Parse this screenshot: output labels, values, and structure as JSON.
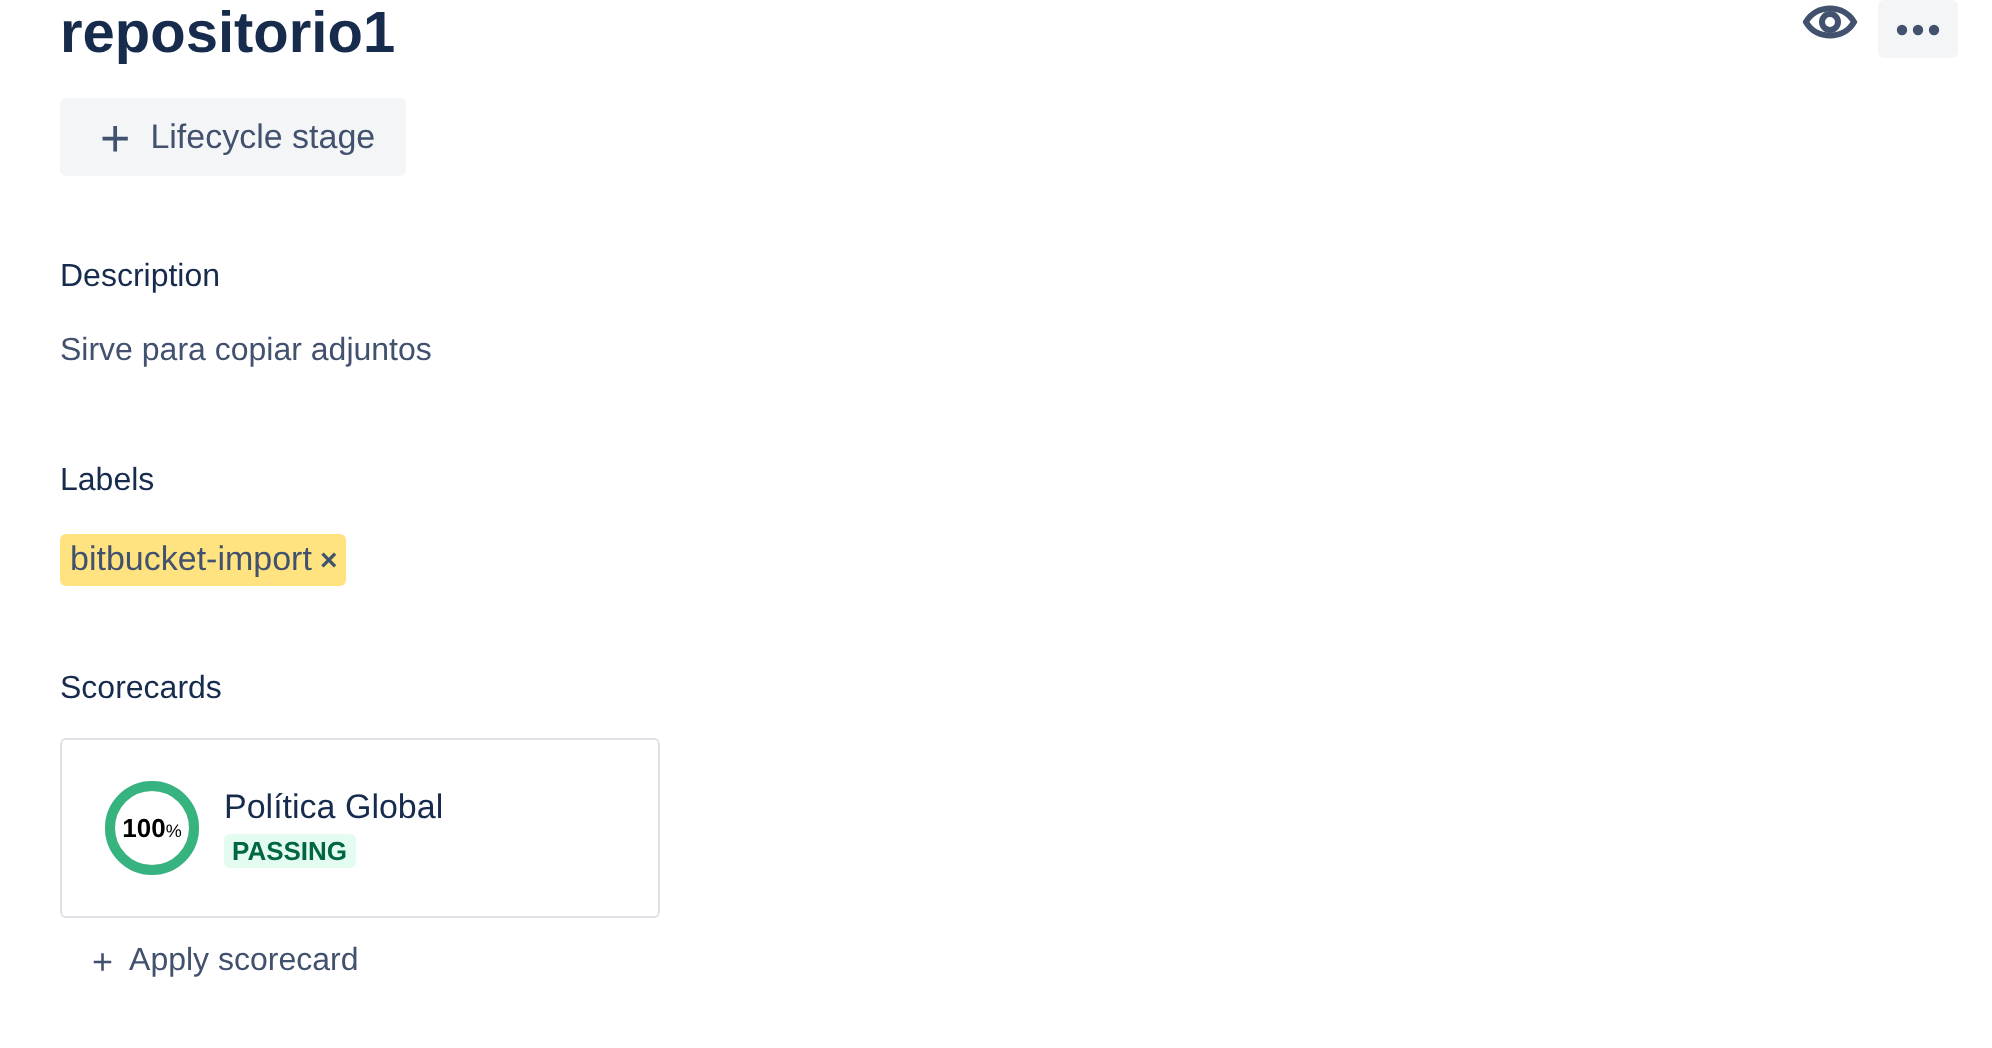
{
  "title": "repositorio1",
  "lifecycle_button": {
    "icon": "+",
    "label": "Lifecycle stage"
  },
  "description": {
    "heading": "Description",
    "text": "Sirve para copiar adjuntos"
  },
  "labels": {
    "heading": "Labels",
    "items": [
      {
        "text": "bitbucket-import",
        "remove": "×"
      }
    ]
  },
  "scorecards": {
    "heading": "Scorecards",
    "items": [
      {
        "name": "Política Global",
        "score": "100",
        "unit": "%",
        "level": 1,
        "status": "PASSING"
      }
    ],
    "apply": {
      "icon": "+",
      "label": "Apply scorecard"
    }
  }
}
